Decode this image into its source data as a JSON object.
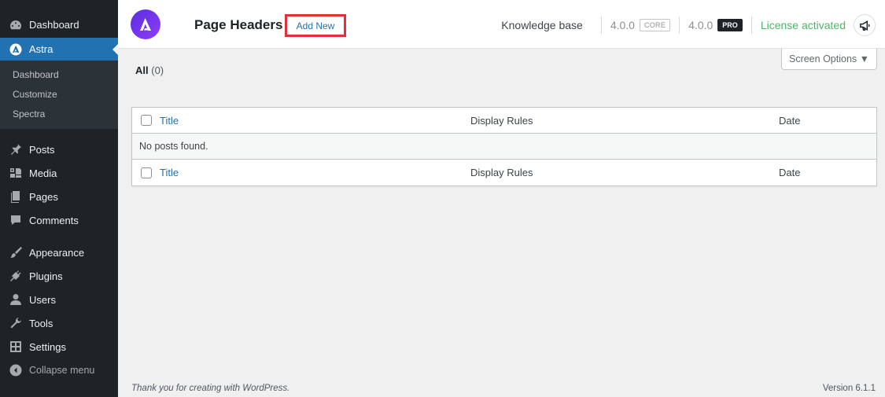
{
  "sidebar": {
    "items_top": [
      {
        "label": "Dashboard",
        "icon": "dashboard-icon"
      },
      {
        "label": "Astra",
        "icon": "astra-icon"
      }
    ],
    "submenu": [
      "Dashboard",
      "Customize",
      "Spectra"
    ],
    "items_bottom": [
      {
        "label": "Posts",
        "icon": "pin-icon"
      },
      {
        "label": "Media",
        "icon": "media-icon"
      },
      {
        "label": "Pages",
        "icon": "pages-icon"
      },
      {
        "label": "Comments",
        "icon": "comment-icon"
      },
      {
        "label": "Appearance",
        "icon": "paintbrush-icon"
      },
      {
        "label": "Plugins",
        "icon": "plugin-icon"
      },
      {
        "label": "Users",
        "icon": "users-icon"
      },
      {
        "label": "Tools",
        "icon": "wrench-icon"
      },
      {
        "label": "Settings",
        "icon": "settings-icon"
      }
    ],
    "collapse_label": "Collapse menu"
  },
  "header": {
    "title": "Page Headers",
    "add_new_label": "Add New",
    "knowledge_base": "Knowledge base",
    "core_version": "4.0.0",
    "core_badge": "CORE",
    "pro_version": "4.0.0",
    "pro_badge": "PRO",
    "license_status": "License activated"
  },
  "screen_options_label": "Screen Options ▼",
  "filter": {
    "label": "All",
    "count": "(0)"
  },
  "table": {
    "columns": {
      "title": "Title",
      "display_rules": "Display Rules",
      "date": "Date"
    },
    "empty_message": "No posts found."
  },
  "footer": {
    "thanks": "Thank you for creating with WordPress.",
    "version": "Version 6.1.1"
  },
  "colors": {
    "sidebar_bg": "#1d2327",
    "active_bg": "#2271b1",
    "link": "#2271b1",
    "license_green": "#4ab866",
    "highlight_red": "#e0303a"
  }
}
